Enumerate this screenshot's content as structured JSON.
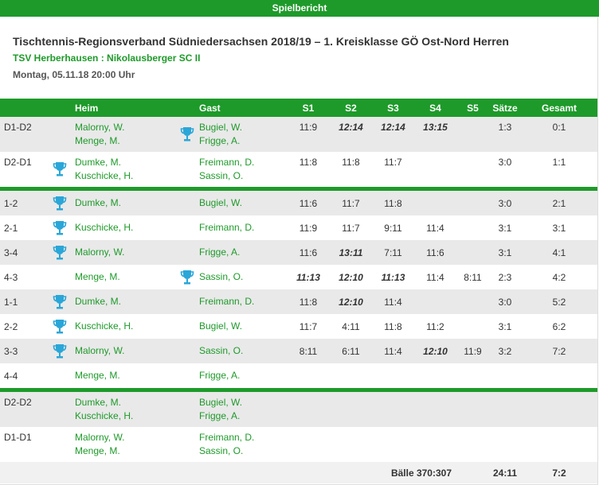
{
  "header": {
    "bar_title": "Spielbericht"
  },
  "match": {
    "title": "Tischtennis-Regionsverband Südniedersachsen 2018/19 – 1. Kreisklasse GÖ Ost-Nord Herren",
    "teams": "TSV Herberhausen : Nikolausberger SC II",
    "datetime": "Montag, 05.11.18 20:00 Uhr"
  },
  "columns": {
    "heim": "Heim",
    "gast": "Gast",
    "s1": "S1",
    "s2": "S2",
    "s3": "S3",
    "s4": "S4",
    "s5": "S5",
    "saetze": "Sätze",
    "gesamt": "Gesamt"
  },
  "colors": {
    "brand_green": "#1e9a2a",
    "cup_blue": "#2aa6d8"
  },
  "rows": [
    {
      "pair": "D1-D2",
      "heim": [
        "Malorny, W.",
        "Menge, M."
      ],
      "gast": [
        "Bugiel, W.",
        "Frigge, A."
      ],
      "winner": "gast",
      "sets": [
        "11:9",
        "12:14",
        "12:14",
        "13:15",
        ""
      ],
      "bold": [
        false,
        true,
        true,
        true,
        false
      ],
      "saetze": "1:3",
      "gesamt": "0:1"
    },
    {
      "pair": "D2-D1",
      "heim": [
        "Dumke, M.",
        "Kuschicke, H."
      ],
      "gast": [
        "Freimann, D.",
        "Sassin, O."
      ],
      "winner": "heim",
      "sets": [
        "11:8",
        "11:8",
        "11:7",
        "",
        ""
      ],
      "bold": [
        false,
        false,
        false,
        false,
        false
      ],
      "saetze": "3:0",
      "gesamt": "1:1"
    },
    {
      "sep": true
    },
    {
      "pair": "1-2",
      "heim": [
        "Dumke, M."
      ],
      "gast": [
        "Bugiel, W."
      ],
      "winner": "heim",
      "sets": [
        "11:6",
        "11:7",
        "11:8",
        "",
        ""
      ],
      "bold": [
        false,
        false,
        false,
        false,
        false
      ],
      "saetze": "3:0",
      "gesamt": "2:1"
    },
    {
      "pair": "2-1",
      "heim": [
        "Kuschicke, H."
      ],
      "gast": [
        "Freimann, D."
      ],
      "winner": "heim",
      "sets": [
        "11:9",
        "11:7",
        "9:11",
        "11:4",
        ""
      ],
      "bold": [
        false,
        false,
        false,
        false,
        false
      ],
      "saetze": "3:1",
      "gesamt": "3:1"
    },
    {
      "pair": "3-4",
      "heim": [
        "Malorny, W."
      ],
      "gast": [
        "Frigge, A."
      ],
      "winner": "heim",
      "sets": [
        "11:6",
        "13:11",
        "7:11",
        "11:6",
        ""
      ],
      "bold": [
        false,
        true,
        false,
        false,
        false
      ],
      "saetze": "3:1",
      "gesamt": "4:1"
    },
    {
      "pair": "4-3",
      "heim": [
        "Menge, M."
      ],
      "gast": [
        "Sassin, O."
      ],
      "winner": "gast",
      "sets": [
        "11:13",
        "12:10",
        "11:13",
        "11:4",
        "8:11"
      ],
      "bold": [
        true,
        true,
        true,
        false,
        false
      ],
      "saetze": "2:3",
      "gesamt": "4:2"
    },
    {
      "pair": "1-1",
      "heim": [
        "Dumke, M."
      ],
      "gast": [
        "Freimann, D."
      ],
      "winner": "heim",
      "sets": [
        "11:8",
        "12:10",
        "11:4",
        "",
        ""
      ],
      "bold": [
        false,
        true,
        false,
        false,
        false
      ],
      "saetze": "3:0",
      "gesamt": "5:2"
    },
    {
      "pair": "2-2",
      "heim": [
        "Kuschicke, H."
      ],
      "gast": [
        "Bugiel, W."
      ],
      "winner": "heim",
      "sets": [
        "11:7",
        "4:11",
        "11:8",
        "11:2",
        ""
      ],
      "bold": [
        false,
        false,
        false,
        false,
        false
      ],
      "saetze": "3:1",
      "gesamt": "6:2"
    },
    {
      "pair": "3-3",
      "heim": [
        "Malorny, W."
      ],
      "gast": [
        "Sassin, O."
      ],
      "winner": "heim",
      "sets": [
        "8:11",
        "6:11",
        "11:4",
        "12:10",
        "11:9"
      ],
      "bold": [
        false,
        false,
        false,
        true,
        false
      ],
      "saetze": "3:2",
      "gesamt": "7:2"
    },
    {
      "pair": "4-4",
      "heim": [
        "Menge, M."
      ],
      "gast": [
        "Frigge, A."
      ],
      "winner": "",
      "sets": [
        "",
        "",
        "",
        "",
        ""
      ],
      "bold": [
        false,
        false,
        false,
        false,
        false
      ],
      "saetze": "",
      "gesamt": ""
    },
    {
      "sep": true
    },
    {
      "pair": "D2-D2",
      "heim": [
        "Dumke, M.",
        "Kuschicke, H."
      ],
      "gast": [
        "Bugiel, W.",
        "Frigge, A."
      ],
      "winner": "",
      "sets": [
        "",
        "",
        "",
        "",
        ""
      ],
      "bold": [
        false,
        false,
        false,
        false,
        false
      ],
      "saetze": "",
      "gesamt": ""
    },
    {
      "pair": "D1-D1",
      "heim": [
        "Malorny, W.",
        "Menge, M."
      ],
      "gast": [
        "Freimann, D.",
        "Sassin, O."
      ],
      "winner": "",
      "sets": [
        "",
        "",
        "",
        "",
        ""
      ],
      "bold": [
        false,
        false,
        false,
        false,
        false
      ],
      "saetze": "",
      "gesamt": ""
    }
  ],
  "footer": {
    "baelle": "Bälle 370:307",
    "saetze": "24:11",
    "gesamt": "7:2"
  }
}
